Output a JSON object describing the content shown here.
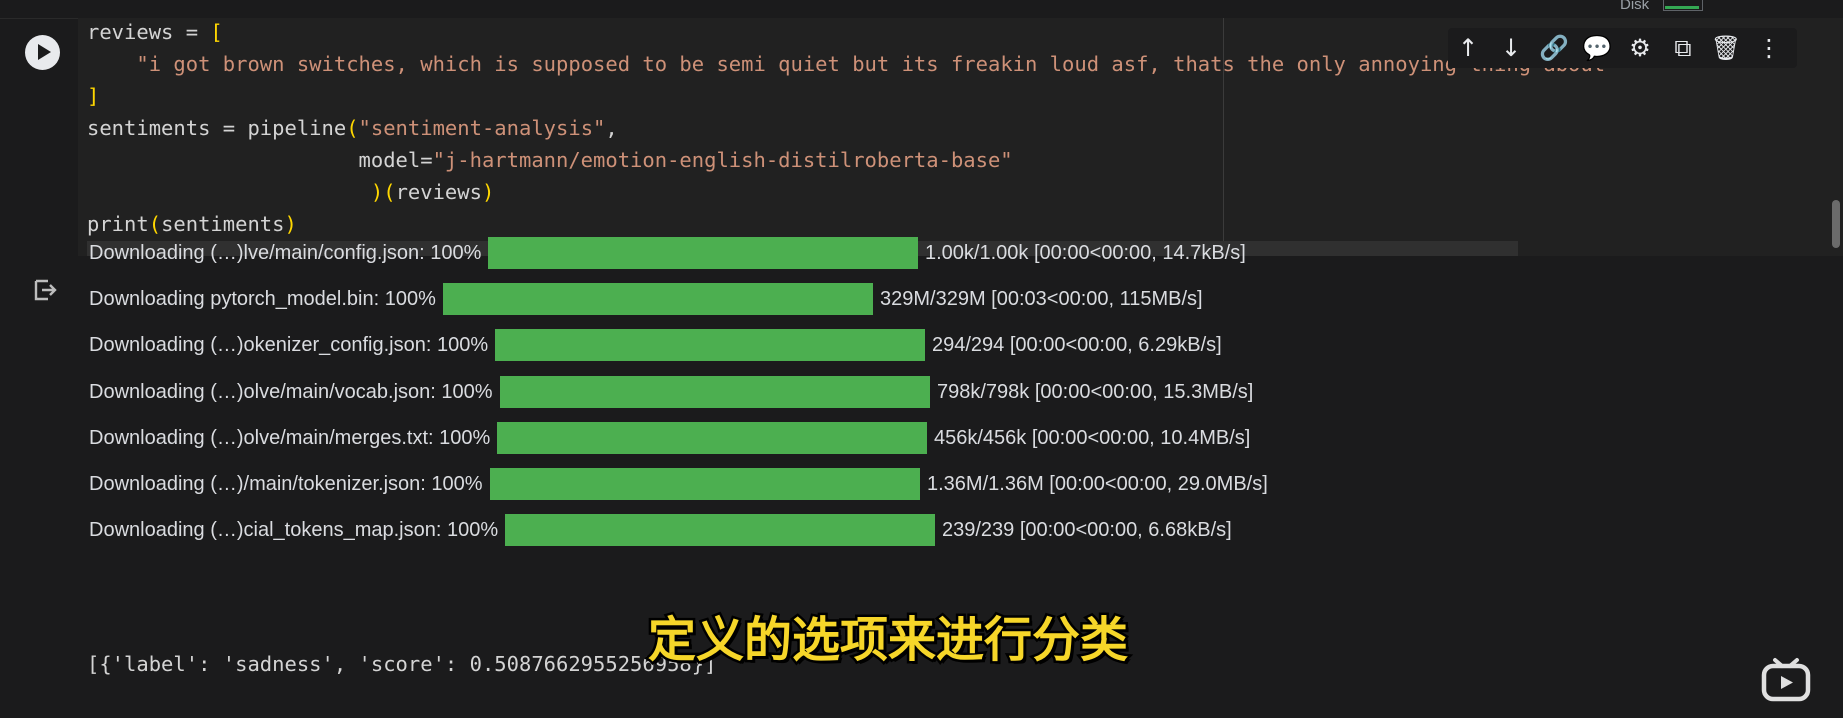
{
  "topbar": {
    "disk_label": "Disk"
  },
  "code_lines": [
    [
      {
        "t": "reviews = "
      },
      {
        "t": "[",
        "c": "b"
      }
    ],
    [
      {
        "t": "    "
      },
      {
        "t": "\"i got brown switches, which is supposed to be semi quiet but its freakin loud asf, thats the only annoying thing about",
        "c": "s"
      }
    ],
    [
      {
        "t": "]",
        "c": "b"
      }
    ],
    [
      {
        "t": "sentiments = pipeline"
      },
      {
        "t": "(",
        "c": "b"
      },
      {
        "t": "\"sentiment-analysis\"",
        "c": "s"
      },
      {
        "t": ","
      }
    ],
    [
      {
        "t": "                      model="
      },
      {
        "t": "\"j-hartmann/emotion-english-distilroberta-base\"",
        "c": "s"
      }
    ],
    [
      {
        "t": "                       "
      },
      {
        "t": ")(",
        "c": "b"
      },
      {
        "t": "reviews"
      },
      {
        "t": ")",
        "c": "b"
      }
    ],
    [
      {
        "t": "print"
      },
      {
        "t": "(",
        "c": "b"
      },
      {
        "t": "sentiments"
      },
      {
        "t": ")",
        "c": "b"
      }
    ]
  ],
  "toolbar": {
    "buttons": [
      {
        "name": "move-cell-up-icon",
        "glyph": "↑"
      },
      {
        "name": "move-cell-down-icon",
        "glyph": "↓"
      },
      {
        "name": "link-icon",
        "glyph": "🔗"
      },
      {
        "name": "comment-icon",
        "glyph": "💬"
      },
      {
        "name": "gear-icon",
        "glyph": "⚙"
      },
      {
        "name": "mirror-cell-icon",
        "glyph": "⧉"
      },
      {
        "name": "trash-icon",
        "glyph": "🗑"
      },
      {
        "name": "more-vert-icon",
        "glyph": "⋮"
      }
    ]
  },
  "downloads": [
    {
      "label": "Downloading (…)lve/main/config.json: 100%",
      "stats": "1.00k/1.00k [00:00<00:00, 14.7kB/s]",
      "progress": 1.0
    },
    {
      "label": "Downloading pytorch_model.bin: 100%",
      "stats": "329M/329M [00:03<00:00, 115MB/s]",
      "progress": 1.0
    },
    {
      "label": "Downloading (…)okenizer_config.json: 100%",
      "stats": "294/294 [00:00<00:00, 6.29kB/s]",
      "progress": 1.0
    },
    {
      "label": "Downloading (…)olve/main/vocab.json: 100%",
      "stats": "798k/798k [00:00<00:00, 15.3MB/s]",
      "progress": 1.0
    },
    {
      "label": "Downloading (…)olve/main/merges.txt: 100%",
      "stats": "456k/456k [00:00<00:00, 10.4MB/s]",
      "progress": 1.0
    },
    {
      "label": "Downloading (…)/main/tokenizer.json: 100%",
      "stats": "1.36M/1.36M [00:00<00:00, 29.0MB/s]",
      "progress": 1.0
    },
    {
      "label": "Downloading (…)cial_tokens_map.json: 100%",
      "stats": "239/239 [00:00<00:00, 6.68kB/s]",
      "progress": 1.0
    }
  ],
  "result_text": "[{'label': 'sadness', 'score': 0.5087662955256958}]",
  "subtitle": "定义的选项来进行分类"
}
